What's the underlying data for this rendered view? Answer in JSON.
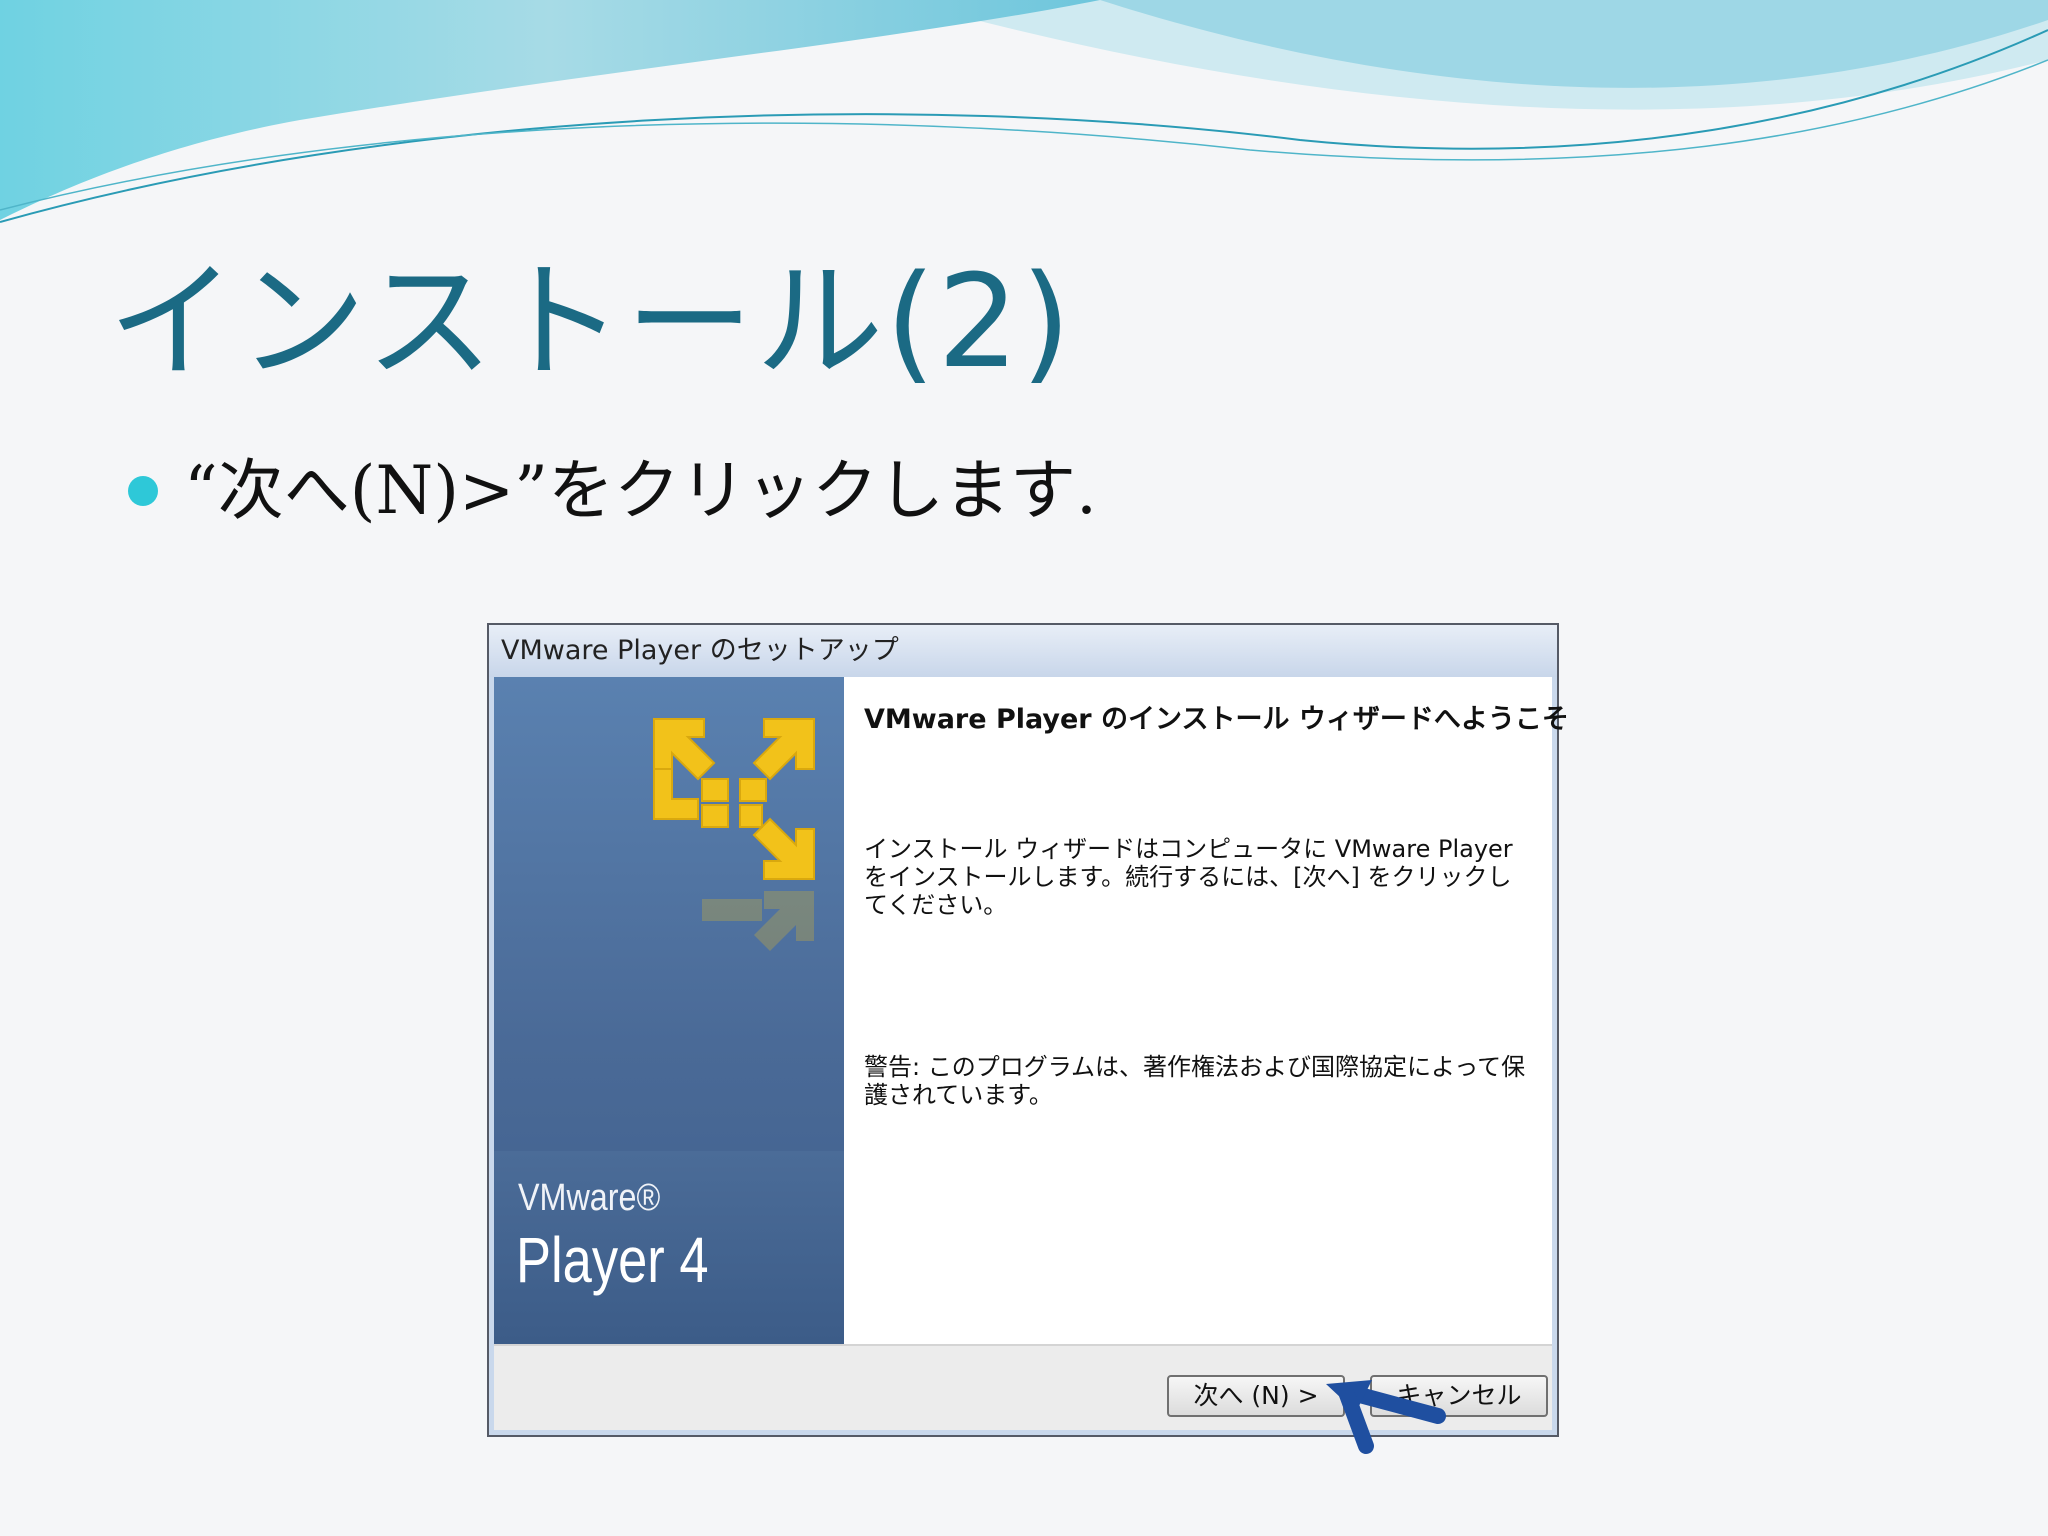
{
  "slide": {
    "title": "インストール(2)",
    "bullet": "“次へ(N)>”をクリックします."
  },
  "dialog": {
    "window_title": "VMware Player のセットアップ",
    "banner": {
      "brand_small": "VMware®",
      "brand_large": "Player 4"
    },
    "heading": "VMware Player のインストール ウィザードへようこそ",
    "paragraph1": "インストール ウィザードはコンピュータに VMware Player をインストールします。続行するには、[次へ] をクリックしてください。",
    "paragraph2": "警告: このプログラムは、著作権法および国際協定によって保護されています。",
    "buttons": {
      "next": "次へ (N) >",
      "cancel": "キャンセル"
    }
  },
  "colors": {
    "title": "#1b6a84",
    "bullet_dot": "#2ec8d8",
    "banner_blue": "#4a6a97",
    "logo_yellow": "#f2c21a",
    "pointer_arrow": "#1f4fa0"
  },
  "icons": [
    "vmware-logo-icon",
    "pointer-arrow-icon"
  ]
}
